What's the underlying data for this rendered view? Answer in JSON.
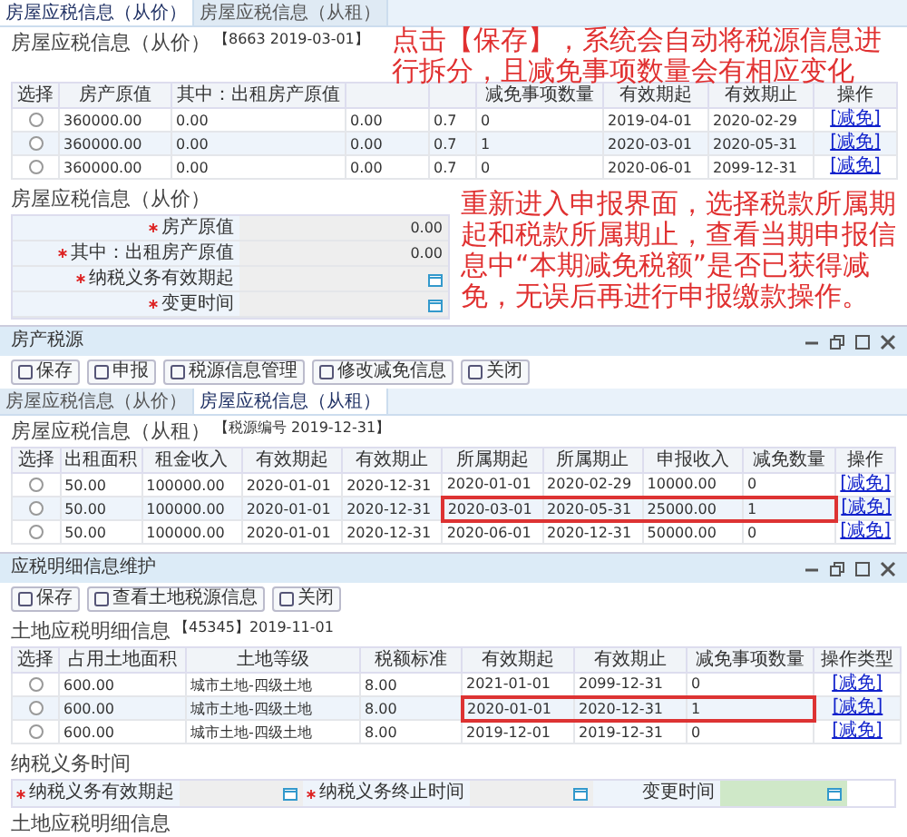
{
  "property_panel": {
    "tabs": [
      {
        "label": "房屋应税信息（从价）",
        "selected": true
      },
      {
        "label": "房屋应税信息（从租）",
        "selected": false
      }
    ],
    "section_title": "房屋应税信息（从价）",
    "source_tag": "【8663 2019-03-01】",
    "table": {
      "select_label": "选择",
      "columns": [
        {
          "label": "房产原值"
        },
        {
          "label": "其中：出租房产原值"
        },
        {},
        {},
        {
          "label": "减免事项数量"
        },
        {
          "label": "有效期起"
        },
        {
          "label": "有效期止"
        },
        {
          "label": "操作"
        }
      ],
      "rows": [
        {
          "selected": false,
          "cells": [
            "360000.00",
            "0.00",
            "0.00",
            "0.7",
            "0",
            "2019-04-01",
            "2020-02-29",
            "[减免]"
          ]
        },
        {
          "selected": false,
          "cells": [
            "360000.00",
            "0.00",
            "0.00",
            "0.7",
            "1",
            "2020-03-01",
            "2020-05-31",
            "[减免]"
          ]
        },
        {
          "selected": false,
          "cells": [
            "360000.00",
            "0.00",
            "0.00",
            "0.7",
            "0",
            "2020-06-01",
            "2099-12-31",
            "[减免]"
          ]
        }
      ]
    },
    "form_title": "房屋应税信息（从价）",
    "form": [
      {
        "label": "房产原值",
        "required": true,
        "kind": "text",
        "value": "0.00"
      },
      {
        "label": "其中：出租房产原值",
        "required": true,
        "kind": "text",
        "value": "0.00"
      },
      {
        "label": "纳税义务有效期起",
        "required": true,
        "kind": "date"
      },
      {
        "label": "变更时间",
        "required": true,
        "kind": "date"
      }
    ]
  },
  "rent_window": {
    "title": "房产税源",
    "toolbar": [
      "保存",
      "申报",
      "税源信息管理",
      "修改减免信息",
      "关闭"
    ],
    "tabs": [
      {
        "label": "房屋应税信息（从价）",
        "selected": false
      },
      {
        "label": "房屋应税信息（从租）",
        "selected": true
      }
    ],
    "section_title": "房屋应税信息（从租）",
    "source_tag": "【税源编号 2019-12-31】",
    "table": {
      "select_label": "选择",
      "columns": [
        {
          "label": "出租面积"
        },
        {
          "label": "租金收入"
        },
        {
          "label": "有效期起"
        },
        {
          "label": "有效期止"
        },
        {
          "label": "所属期起"
        },
        {
          "label": "所属期止"
        },
        {
          "label": "申报收入"
        },
        {
          "label": "减免数量"
        },
        {
          "label": "操作"
        }
      ],
      "rows": [
        {
          "selected": false,
          "cells": [
            "50.00",
            "100000.00",
            "2020-01-01",
            "2020-12-31",
            "2020-01-01",
            "2020-02-29",
            "10000.00",
            "0",
            "[减免]"
          ]
        },
        {
          "selected": false,
          "cells": [
            "50.00",
            "100000.00",
            "2020-01-01",
            "2020-12-31",
            "2020-03-01",
            "2020-05-31",
            "25000.00",
            "1",
            "[减免]"
          ],
          "boxed_cells": [
            false,
            false,
            false,
            false,
            true,
            true,
            true,
            true
          ]
        },
        {
          "selected": false,
          "cells": [
            "50.00",
            "100000.00",
            "2020-01-01",
            "2020-12-31",
            "2020-06-01",
            "2020-12-31",
            "50000.00",
            "0",
            "[减免]"
          ]
        }
      ]
    }
  },
  "land_window": {
    "title": "应税明细信息维护",
    "toolbar": [
      "保存",
      "查看土地税源信息",
      "关闭"
    ],
    "section_title": "土地应税明细信息",
    "source_tag": "【45345】2019-11-01",
    "table": {
      "select_label": "选择",
      "columns": [
        {
          "label": "占用土地面积"
        },
        {
          "label": "土地等级"
        },
        {
          "label": "税额标准"
        },
        {
          "label": "有效期起"
        },
        {
          "label": "有效期止"
        },
        {
          "label": "减免事项数量"
        },
        {
          "label": "操作类型"
        }
      ],
      "rows": [
        {
          "selected": false,
          "cells": [
            "600.00",
            "城市土地-四级土地",
            "8.00",
            "2021-01-01",
            "2099-12-31",
            "0",
            "[减免]"
          ]
        },
        {
          "selected": false,
          "cells": [
            "600.00",
            "城市土地-四级土地",
            "8.00",
            "2020-01-01",
            "2020-12-31",
            "1",
            "[减免]"
          ],
          "boxed_cells": [
            false,
            false,
            false,
            true,
            true,
            true
          ]
        },
        {
          "selected": false,
          "cells": [
            "600.00",
            "城市土地-四级土地",
            "8.00",
            "2019-12-01",
            "2019-12-31",
            "0",
            "[减免]"
          ]
        }
      ]
    },
    "duty_title": "纳税义务时间",
    "duty_fields": [
      {
        "label": "纳税义务有效期起",
        "required": true,
        "filled": false
      },
      {
        "label": "纳税义务终止时间",
        "required": true,
        "filled": false
      },
      {
        "label": "变更时间",
        "required": false,
        "filled": true
      }
    ],
    "detail_title": "土地应税明细信息"
  },
  "annotations": [
    "点击【保存】，系统会自动将税源信息进行拆分，且减免事项数量会有相应变化",
    "重新进入申报界面，选择税款所属期起和税款所属期止，查看当期申报信息中“本期减免税额”是否已获得减免，无误后再进行申报缴款操作。"
  ]
}
